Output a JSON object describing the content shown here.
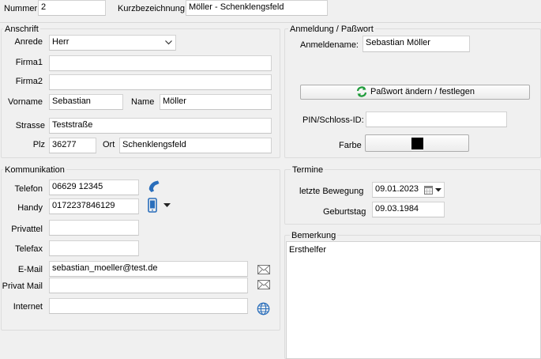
{
  "top": {
    "nummer_label": "Nummer",
    "nummer_value": "2",
    "kurz_label": "Kurzbezeichnung",
    "kurz_value": "Möller - Schenklengsfeld"
  },
  "anschrift": {
    "title": "Anschrift",
    "anrede_label": "Anrede",
    "anrede_value": "Herr",
    "firma1_label": "Firma1",
    "firma1_value": "",
    "firma2_label": "Firma2",
    "firma2_value": "",
    "vorname_label": "Vorname",
    "vorname_value": "Sebastian",
    "name_label": "Name",
    "name_value": "Möller",
    "strasse_label": "Strasse",
    "strasse_value": "Teststraße",
    "plz_label": "Plz",
    "plz_value": "36277",
    "ort_label": "Ort",
    "ort_value": "Schenklengsfeld"
  },
  "anmeldung": {
    "title": "Anmeldung / Paßwort",
    "anmeldename_label": "Anmeldename:",
    "anmeldename_value": "Sebastian Möller",
    "passwort_button": "Paßwort ändern / festlegen",
    "pin_label": "PIN/Schloss-ID:",
    "pin_value": "",
    "farbe_label": "Farbe",
    "farbe_color": "#000000"
  },
  "kommunikation": {
    "title": "Kommunikation",
    "telefon_label": "Telefon",
    "telefon_value": "06629 12345",
    "handy_label": "Handy",
    "handy_value": "0172237846129",
    "privattel_label": "Privattel",
    "privattel_value": "",
    "telefax_label": "Telefax",
    "telefax_value": "",
    "email_label": "E-Mail",
    "email_value": "sebastian_moeller@test.de",
    "privatmail_label": "Privat Mail",
    "privatmail_value": "",
    "internet_label": "Internet",
    "internet_value": ""
  },
  "termine": {
    "title": "Termine",
    "bewegung_label": "letzte Bewegung",
    "bewegung_value": "09.01.2023",
    "geburtstag_label": "Geburtstag",
    "geburtstag_value": "09.03.1984"
  },
  "bemerkung": {
    "title": "Bemerkung",
    "text": "Ersthelfer"
  },
  "colors": {
    "icon_blue": "#2a6ebb",
    "refresh_green": "#1e9b3a"
  }
}
